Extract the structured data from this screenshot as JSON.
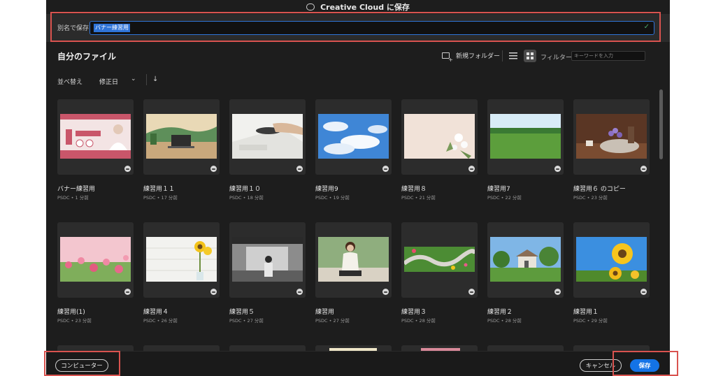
{
  "dialog": {
    "title": "Creative Cloud に保存"
  },
  "save_as": {
    "label": "別名で保存",
    "value": "バナー練習用"
  },
  "section": {
    "title": "自分のファイル",
    "new_folder_label": "新規フォルダー",
    "filter_label": "フィルター",
    "filter_placeholder": "キーワードを入力"
  },
  "sort": {
    "label": "並べ替え",
    "value": "修正日",
    "chevron": "⌄",
    "direction": "↓"
  },
  "files": [
    {
      "name": "バナー練習用",
      "meta": "PSDC • 1 分前"
    },
    {
      "name": "練習用１１",
      "meta": "PSDC • 17 分前"
    },
    {
      "name": "練習用１０",
      "meta": "PSDC • 18 分前"
    },
    {
      "name": "練習用9",
      "meta": "PSDC • 19 分前"
    },
    {
      "name": "練習用８",
      "meta": "PSDC • 21 分前"
    },
    {
      "name": "練習用7",
      "meta": "PSDC • 22 分前"
    },
    {
      "name": "練習用６ のコピー",
      "meta": "PSDC • 23 分前"
    },
    {
      "name": "練習用(1)",
      "meta": "PSDC • 23 分前"
    },
    {
      "name": "練習用４",
      "meta": "PSDC • 26 分前"
    },
    {
      "name": "練習用５",
      "meta": "PSDC • 27 分前"
    },
    {
      "name": "練習用",
      "meta": "PSDC • 27 分前"
    },
    {
      "name": "練習用３",
      "meta": "PSDC • 28 分前"
    },
    {
      "name": "練習用２",
      "meta": "PSDC • 28 分前"
    },
    {
      "name": "練習用１",
      "meta": "PSDC • 29 分前"
    }
  ],
  "footer": {
    "computer_label": "コンピューター",
    "cancel_label": "キャンセル",
    "save_label": "保存"
  },
  "colors": {
    "accent": "#1473e6",
    "highlight": "#d9534f"
  }
}
